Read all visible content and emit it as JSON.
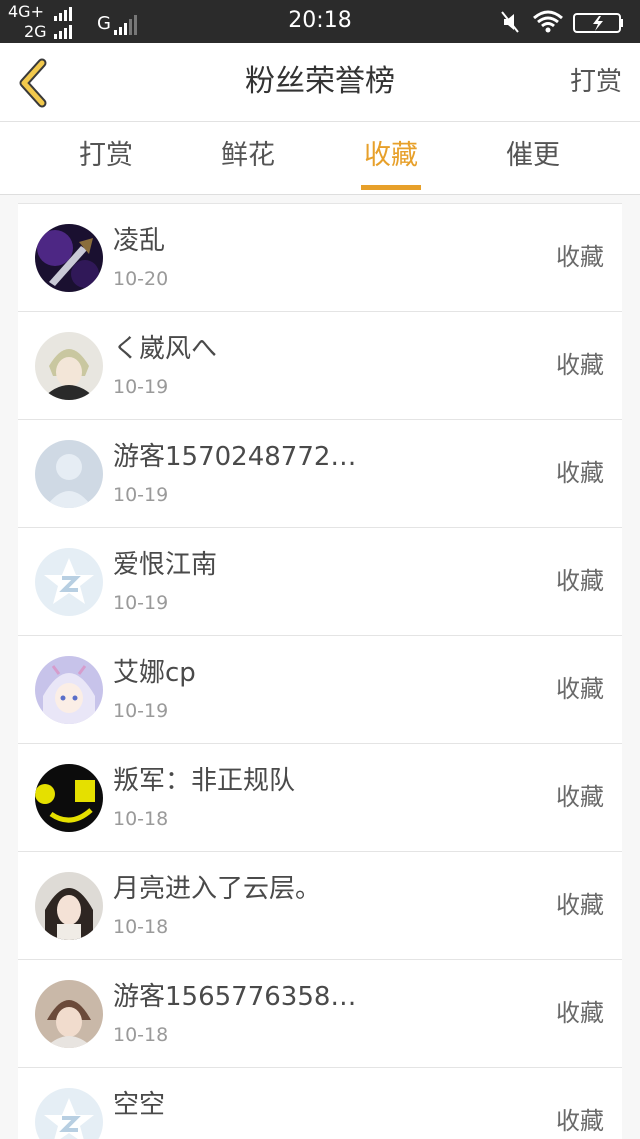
{
  "status_bar": {
    "network_top": "4G+",
    "network_bottom": "2G",
    "network_g": "G",
    "time": "20:18"
  },
  "header": {
    "title": "粉丝荣誉榜",
    "action": "打赏"
  },
  "tabs": [
    {
      "label": "打赏",
      "active": false
    },
    {
      "label": "鲜花",
      "active": false
    },
    {
      "label": "收藏",
      "active": true
    },
    {
      "label": "催更",
      "active": false
    }
  ],
  "colors": {
    "accent": "#e7a02a",
    "text_primary": "#4a4a4a",
    "text_secondary": "#9a9a9a"
  },
  "fans": [
    {
      "name": "凌乱",
      "date": "10-20",
      "action": "收藏",
      "avatar": "sword-avatar-icon"
    },
    {
      "name": "く崴风へ",
      "date": "10-19",
      "action": "收藏",
      "avatar": "anime-boy-avatar-icon"
    },
    {
      "name": "游客1570248772…",
      "date": "10-19",
      "action": "收藏",
      "avatar": "default-person-avatar-icon"
    },
    {
      "name": "爱恨江南",
      "date": "10-19",
      "action": "收藏",
      "avatar": "default-star-avatar-icon"
    },
    {
      "name": "艾娜cp",
      "date": "10-19",
      "action": "收藏",
      "avatar": "anime-girl-avatar-icon"
    },
    {
      "name": "叛军：非正规队",
      "date": "10-18",
      "action": "收藏",
      "avatar": "dark-yellow-avatar-icon"
    },
    {
      "name": "月亮进入了云层。",
      "date": "10-18",
      "action": "收藏",
      "avatar": "girl-photo-avatar-icon"
    },
    {
      "name": "游客1565776358…",
      "date": "10-18",
      "action": "收藏",
      "avatar": "boy-photo-avatar-icon"
    },
    {
      "name": "空空",
      "date": "",
      "action": "收藏",
      "avatar": "default-star-avatar-icon"
    }
  ]
}
